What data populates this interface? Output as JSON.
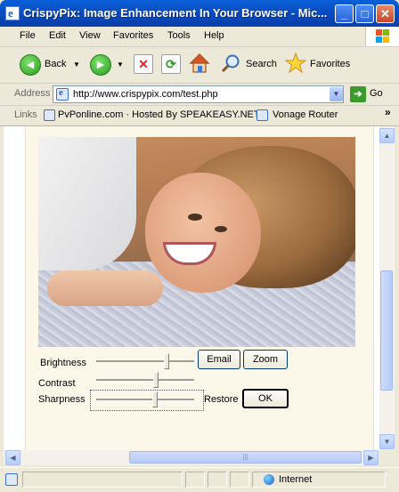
{
  "window": {
    "title": "CrispyPix: Image Enhancement In Your Browser - Mic...",
    "app_icon_glyph": "e",
    "minimize_glyph": "_",
    "maximize_glyph": "□",
    "close_glyph": "✕"
  },
  "menu": {
    "items": [
      {
        "label": "File"
      },
      {
        "label": "Edit"
      },
      {
        "label": "View"
      },
      {
        "label": "Favorites"
      },
      {
        "label": "Tools"
      },
      {
        "label": "Help"
      }
    ]
  },
  "toolbar": {
    "back_label": "Back",
    "search_label": "Search",
    "favorites_label": "Favorites",
    "stop_glyph": "✕",
    "refresh_glyph": "⟳",
    "dropdown_glyph": "▼",
    "back_glyph": "◀",
    "forward_glyph": "▶"
  },
  "address": {
    "label": "Address",
    "url": "http://www.crispypix.com/test.php",
    "go_label": "Go",
    "go_glyph": "➔",
    "page_icon_glyph": "e",
    "drop_glyph": "▼"
  },
  "links": {
    "label": "Links",
    "items": [
      {
        "label": "PvPonline.com · Hosted By SPEAKEASY.NET"
      },
      {
        "label": "Vonage Router"
      }
    ],
    "chevron": "»"
  },
  "controls": {
    "brightness_label": "Brightness",
    "contrast_label": "Contrast",
    "sharpness_label": "Sharpness",
    "email_button": "Email",
    "zoom_button": "Zoom",
    "restore_label": "Restore",
    "ok_button": "OK",
    "brightness_value": 0.73,
    "contrast_value": 0.62,
    "sharpness_value": 0.61
  },
  "scrollbars": {
    "up_glyph": "▲",
    "down_glyph": "▼",
    "left_glyph": "◀",
    "right_glyph": "▶",
    "grip_glyph": "|||"
  },
  "status": {
    "zone_label": "Internet"
  },
  "icons": {
    "app": "ie-icon",
    "back": "back-arrow-icon",
    "forward": "forward-arrow-icon",
    "stop": "stop-icon",
    "refresh": "refresh-icon",
    "home": "home-icon",
    "search": "search-icon",
    "favorites": "star-icon",
    "go": "go-arrow-icon",
    "zone": "globe-icon"
  },
  "colors": {
    "titlebar": "#0a4fc4",
    "chrome": "#ece9d8",
    "content_bg": "#fbf8ea"
  }
}
